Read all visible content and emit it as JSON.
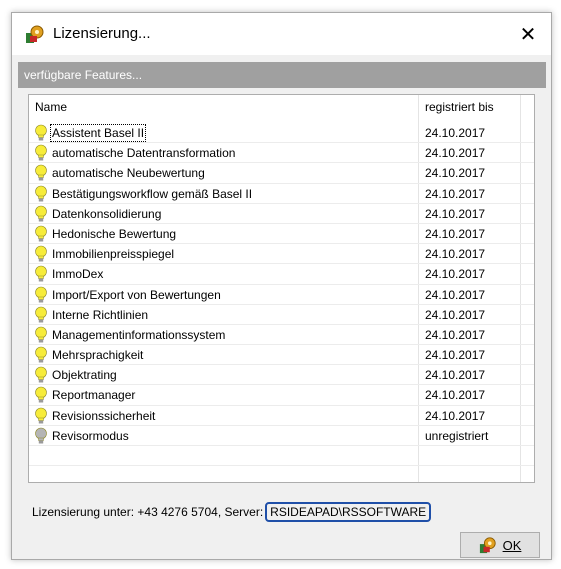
{
  "window": {
    "title": "Lizensierung...",
    "close_glyph": "✕",
    "icon": "gear-shield-icon"
  },
  "banner": {
    "text": "verfügbare Features..."
  },
  "list": {
    "columns": [
      "Name",
      "registriert bis"
    ],
    "rows": [
      {
        "name": "Assistent Basel II",
        "until": "24.10.2017",
        "status": "registered"
      },
      {
        "name": "automatische Datentransformation",
        "until": "24.10.2017",
        "status": "registered"
      },
      {
        "name": "automatische Neubewertung",
        "until": "24.10.2017",
        "status": "registered"
      },
      {
        "name": "Bestätigungsworkflow gemäß Basel II",
        "until": "24.10.2017",
        "status": "registered"
      },
      {
        "name": "Datenkonsolidierung",
        "until": "24.10.2017",
        "status": "registered"
      },
      {
        "name": "Hedonische Bewertung",
        "until": "24.10.2017",
        "status": "registered"
      },
      {
        "name": "Immobilienpreisspiegel",
        "until": "24.10.2017",
        "status": "registered"
      },
      {
        "name": "ImmoDex",
        "until": "24.10.2017",
        "status": "registered"
      },
      {
        "name": "Import/Export von Bewertungen",
        "until": "24.10.2017",
        "status": "registered"
      },
      {
        "name": "Interne Richtlinien",
        "until": "24.10.2017",
        "status": "registered"
      },
      {
        "name": "Managementinformationssystem",
        "until": "24.10.2017",
        "status": "registered"
      },
      {
        "name": "Mehrsprachigkeit",
        "until": "24.10.2017",
        "status": "registered"
      },
      {
        "name": "Objektrating",
        "until": "24.10.2017",
        "status": "registered"
      },
      {
        "name": "Reportmanager",
        "until": "24.10.2017",
        "status": "registered"
      },
      {
        "name": "Revisionssicherheit",
        "until": "24.10.2017",
        "status": "registered"
      },
      {
        "name": "Revisormodus",
        "until": "unregistriert",
        "status": "unregistered"
      }
    ]
  },
  "footer": {
    "label": "Lizensierung unter: +43 4276 5704, Server:",
    "server": "RSIDEAPAD\\RSSOFTWARE"
  },
  "ok_button": {
    "label": "OK"
  },
  "colors": {
    "banner": "#a0a0a0",
    "bulb_on": "#f7ec3a",
    "bulb_off": "#b5b5b5",
    "server_highlight": "#1f4fa8"
  }
}
